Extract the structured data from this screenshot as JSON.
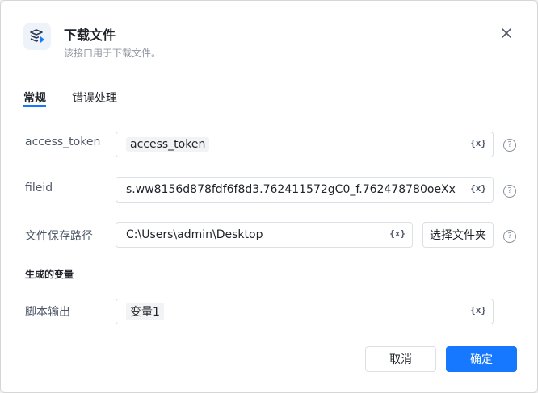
{
  "header": {
    "title": "下载文件",
    "subtitle": "该接口用于下载文件。",
    "icon": "download-file-icon"
  },
  "tabs": [
    {
      "label": "常规",
      "active": true
    },
    {
      "label": "错误处理",
      "active": false
    }
  ],
  "fields": [
    {
      "label": "access_token",
      "value": "access_token",
      "value_is_variable": true
    },
    {
      "label": "fileid",
      "value": "s.ww8156d878fdf6f8d3.762411572gC0_f.762478780oeXx",
      "value_is_variable": false
    },
    {
      "label": "文件保存路径",
      "value": "C:\\Users\\admin\\Desktop",
      "value_is_variable": false,
      "button": "选择文件夹"
    }
  ],
  "var_button_label": "{x}",
  "help_label": "?",
  "output_section": {
    "title": "生成的变量",
    "label": "脚本输出",
    "value": "变量1"
  },
  "footer": {
    "cancel": "取消",
    "confirm": "确定"
  },
  "colors": {
    "accent": "#1677ff",
    "border": "#dcdfe6",
    "text": "#1f2329",
    "muted": "#8f959e"
  }
}
